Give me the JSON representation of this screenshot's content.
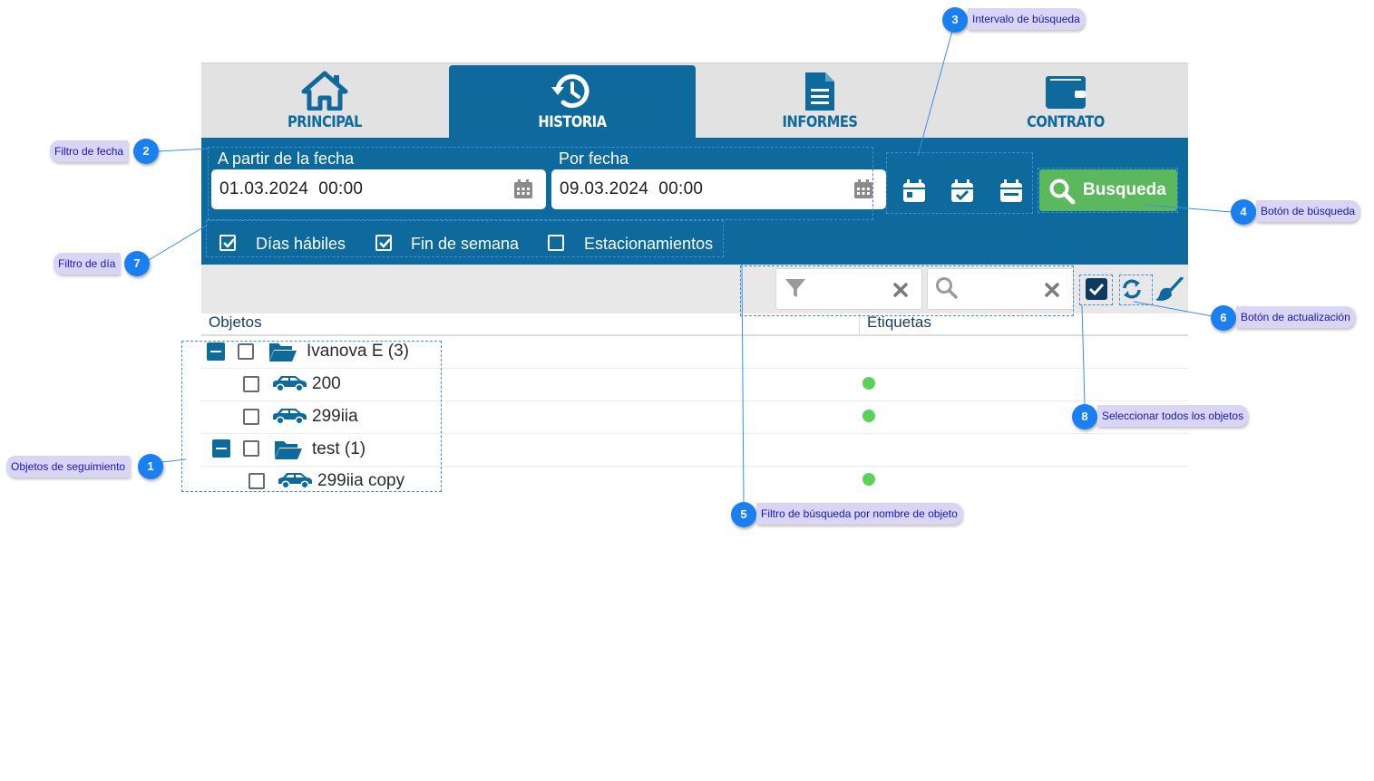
{
  "tabs": [
    {
      "label": "PRINCIPAL",
      "icon": "home-icon",
      "active": false
    },
    {
      "label": "HISTORIA",
      "icon": "history-icon",
      "active": true
    },
    {
      "label": "INFORMES",
      "icon": "document-icon",
      "active": false
    },
    {
      "label": "CONTRATO",
      "icon": "wallet-icon",
      "active": false
    }
  ],
  "date_filter": {
    "from_label": "A partir de la fecha",
    "from_value": "01.03.2024  00:00",
    "to_label": "Por fecha",
    "to_value": "09.03.2024  00:00"
  },
  "range_icons": [
    "calendar-day-icon",
    "calendar-check-icon",
    "calendar-range-icon"
  ],
  "search_button": {
    "label": "Busqueda",
    "icon": "search-icon"
  },
  "day_filter": [
    {
      "label": "Días hábiles",
      "checked": true
    },
    {
      "label": "Fin de semana",
      "checked": true
    },
    {
      "label": "Estacionamientos",
      "checked": false
    }
  ],
  "toolbar": {
    "filter_icon": "filter-icon",
    "search_icon": "search-icon",
    "clear_icon": "close-icon",
    "select_all_icon": "checkbox-checked-icon",
    "refresh_icon": "refresh-icon",
    "clean_icon": "brush-icon"
  },
  "columns": {
    "objects": "Objetos",
    "tags": "Etiquetas"
  },
  "tree": [
    {
      "label": "Ivanova E (3)",
      "type": "folder",
      "expanded": true,
      "checked": false
    },
    {
      "label": "200",
      "type": "car",
      "checked": false,
      "tag": true
    },
    {
      "label": "299iia",
      "type": "car",
      "checked": false,
      "tag": true
    },
    {
      "label": "test (1)",
      "type": "folder",
      "expanded": true,
      "checked": false
    },
    {
      "label": "299iia copy",
      "type": "car",
      "checked": false,
      "tag": true
    }
  ],
  "annotations": [
    {
      "number": "1",
      "text": "Objetos de seguimiento"
    },
    {
      "number": "2",
      "text": "Filtro de fecha"
    },
    {
      "number": "3",
      "text": "Intervalo de búsqueda"
    },
    {
      "number": "4",
      "text": "Botón de búsqueda"
    },
    {
      "number": "5",
      "text": "Filtro de búsqueda por nombre de objeto"
    },
    {
      "number": "6",
      "text": "Botón de actualización"
    },
    {
      "number": "7",
      "text": "Filtro de día"
    },
    {
      "number": "8",
      "text": "Seleccionar todos los objetos"
    }
  ],
  "colors": {
    "primary": "#0e6a9c",
    "success": "#5cb85c",
    "tag_dot": "#5ad25a",
    "annotation": "#1a7ff0",
    "callout_bg": "#d9d6f5"
  }
}
